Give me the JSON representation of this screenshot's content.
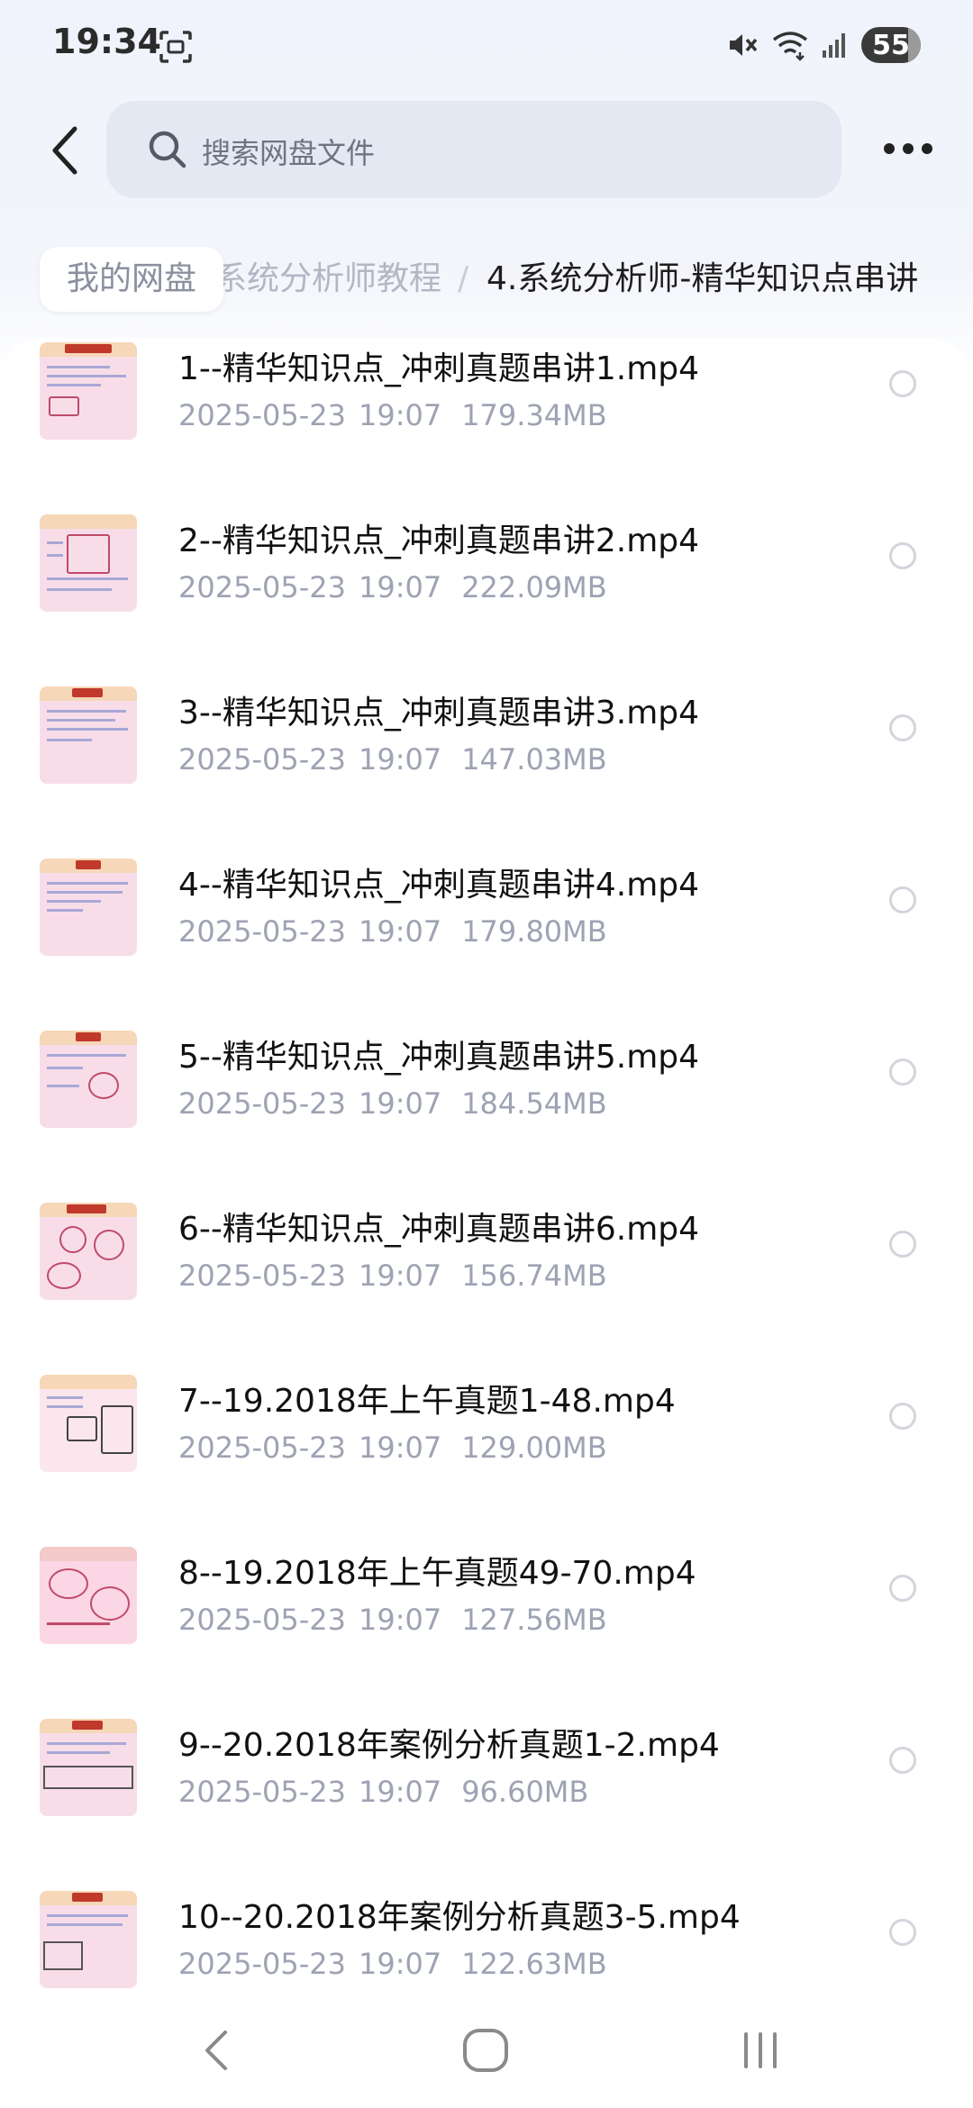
{
  "status_bar": {
    "time": "19:34",
    "battery": "55",
    "icons": [
      "screenshot-icon",
      "mute-icon",
      "wifi-icon",
      "signal-icon"
    ]
  },
  "top_bar": {
    "search_placeholder": "搜索网盘文件",
    "icons": [
      "back-arrow-icon",
      "search-icon",
      "more-dots-icon"
    ]
  },
  "breadcrumb": {
    "root": "我的网盘",
    "parent": "系统分析师教程",
    "separator": "/",
    "current": "4.系统分析师-精华知识点串讲"
  },
  "files": [
    {
      "name": "1--精华知识点_冲刺真题串讲1.mp4",
      "date": "2025-05-23",
      "time": "19:07",
      "size": "179.34MB"
    },
    {
      "name": "2--精华知识点_冲刺真题串讲2.mp4",
      "date": "2025-05-23",
      "time": "19:07",
      "size": "222.09MB"
    },
    {
      "name": "3--精华知识点_冲刺真题串讲3.mp4",
      "date": "2025-05-23",
      "time": "19:07",
      "size": "147.03MB"
    },
    {
      "name": "4--精华知识点_冲刺真题串讲4.mp4",
      "date": "2025-05-23",
      "time": "19:07",
      "size": "179.80MB"
    },
    {
      "name": "5--精华知识点_冲刺真题串讲5.mp4",
      "date": "2025-05-23",
      "time": "19:07",
      "size": "184.54MB"
    },
    {
      "name": "6--精华知识点_冲刺真题串讲6.mp4",
      "date": "2025-05-23",
      "time": "19:07",
      "size": "156.74MB"
    },
    {
      "name": "7--19.2018年上午真题1-48.mp4",
      "date": "2025-05-23",
      "time": "19:07",
      "size": "129.00MB"
    },
    {
      "name": "8--19.2018年上午真题49-70.mp4",
      "date": "2025-05-23",
      "time": "19:07",
      "size": "127.56MB"
    },
    {
      "name": "9--20.2018年案例分析真题1-2.mp4",
      "date": "2025-05-23",
      "time": "19:07",
      "size": "96.60MB"
    },
    {
      "name": "10--20.2018年案例分析真题3-5.mp4",
      "date": "2025-05-23",
      "time": "19:07",
      "size": "122.63MB"
    }
  ],
  "nav_bar": {
    "icons": [
      "nav-back-icon",
      "nav-home-icon",
      "nav-recents-icon"
    ]
  }
}
